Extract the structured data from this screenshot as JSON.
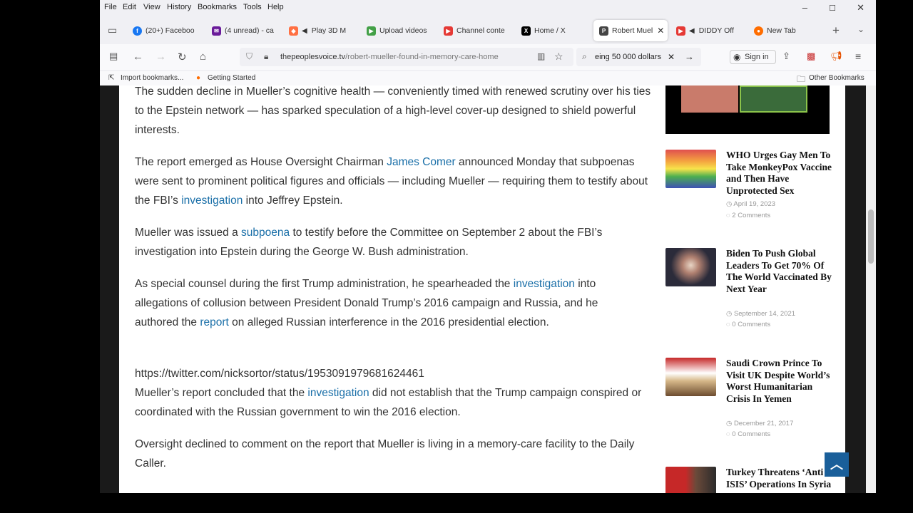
{
  "menu": [
    "File",
    "Edit",
    "View",
    "History",
    "Bookmarks",
    "Tools",
    "Help"
  ],
  "tabs": [
    {
      "label": "(20+) Faceboo",
      "icon": "facebook-icon",
      "color": "#1877f2"
    },
    {
      "label": "(4 unread) - ca",
      "icon": "mail-icon",
      "color": "#6a1b9a"
    },
    {
      "label": "Play 3D M",
      "icon": "game-icon",
      "color": "#ff7043"
    },
    {
      "label": "Upload videos",
      "icon": "upload-icon",
      "color": "#43a047"
    },
    {
      "label": "Channel conte",
      "icon": "youtube-icon",
      "color": "#e53935"
    },
    {
      "label": "Home / X",
      "icon": "x-icon",
      "color": "#000000"
    },
    {
      "label": "Robert Muel",
      "icon": "site-icon",
      "color": "#444444"
    },
    {
      "label": "DIDDY Off",
      "icon": "youtube-icon",
      "color": "#e53935"
    },
    {
      "label": "New Tab",
      "icon": "firefox-icon",
      "color": "#ff6d00"
    }
  ],
  "nav": {
    "url_host": "thepeoplesvoice.tv",
    "url_path": "/robert-mueller-found-in-memory-care-home",
    "search_value": "eing 50 000 dollars",
    "sign_in": "Sign in"
  },
  "bookmarks": {
    "import": "Import bookmarks...",
    "getting_started": "Getting Started",
    "other": "Other Bookmarks"
  },
  "article": {
    "p1": "The sudden decline in Mueller’s cognitive health — conveniently timed with renewed scrutiny over his ties to the Epstein network — has sparked speculation of a high-level cover-up designed to shield powerful interests.",
    "p2a": "The report emerged as House Oversight Chairman ",
    "p2link": "James Comer",
    "p2b": " announced Monday that subpoenas were sent to prominent political figures and officials — including Mueller — requiring them to testify about the FBI’s ",
    "p2link2": "investigation",
    "p2c": " into Jeffrey Epstein.",
    "p3a": "Mueller was issued a ",
    "p3link": "subpoena",
    "p3b": " to testify before the Committee on September 2 about the FBI’s investigation into Epstein during the George W. Bush administration.",
    "p4a": "As special counsel during the first Trump administration, he spearheaded the ",
    "p4link": "investigation",
    "p4b": " into allegations of collusion between President Donald Trump’s 2016 campaign and Russia, and he authored the ",
    "p4link2": "report",
    "p4c": " on alleged Russian interference in the 2016 presidential election.",
    "tweet": "https://twitter.com/nicksortor/status/1953091979681624461",
    "p5a": "Mueller’s report concluded that the ",
    "p5link": "investigation",
    "p5b": " did not establish that the Trump campaign conspired or coordinated with the Russian government to win the 2016 election.",
    "p6": "Oversight declined to comment on the report that Mueller is living in a memory-care facility to the Daily Caller."
  },
  "sidebar": [
    {
      "title": "WHO Urges Gay Men To Take MonkeyPox Vaccine and Then Have Unprotected Sex",
      "date": "April 19, 2023",
      "comments": "2 Comments"
    },
    {
      "title": "Biden To Push Global Leaders To Get 70% Of The World Vaccinated By Next Year",
      "date": "September 14, 2021",
      "comments": "0 Comments"
    },
    {
      "title": "Saudi Crown Prince To Visit UK Despite World’s Worst Humanitarian Crisis In Yemen",
      "date": "December 21, 2017",
      "comments": "0 Comments"
    },
    {
      "title": "Turkey Threatens ‘Anti ISIS’ Operations In Syria",
      "date": "",
      "comments": ""
    }
  ],
  "colors": {
    "link": "#1a6fa8",
    "scroll_button": "#1a5f9a"
  }
}
